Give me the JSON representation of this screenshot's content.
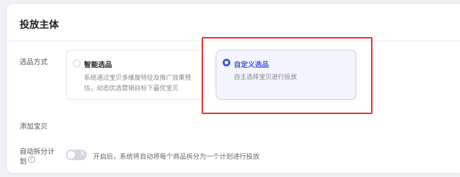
{
  "section": {
    "title": "投放主体"
  },
  "selection_method": {
    "label": "选品方式",
    "options": [
      {
        "title": "智能选品",
        "desc_line1": "系统通过宝贝多维度特征及推广效果预",
        "desc_line2": "估，动态优选营销目标下最优宝贝",
        "selected": false
      },
      {
        "title": "自定义选品",
        "desc_line1": "自主选择宝贝进行投放",
        "selected": true
      }
    ]
  },
  "add_product": {
    "label": "添加宝贝"
  },
  "auto_split": {
    "label_line1": "自动拆分计",
    "label_line2": "划",
    "help_icon_glyph": "?",
    "toggle_text": "关",
    "toggle_on": false,
    "description": "开启后，系统将自动将每个商品拆分为一个计划进行投放"
  },
  "colors": {
    "accent": "#3b55d9",
    "highlight_box": "#e0302c",
    "toggle_off": "#d4d6e0"
  },
  "icons": {
    "radio_selected": "radio-checked-icon",
    "radio_unselected": "radio-unchecked-icon",
    "help": "question-circle-icon"
  }
}
